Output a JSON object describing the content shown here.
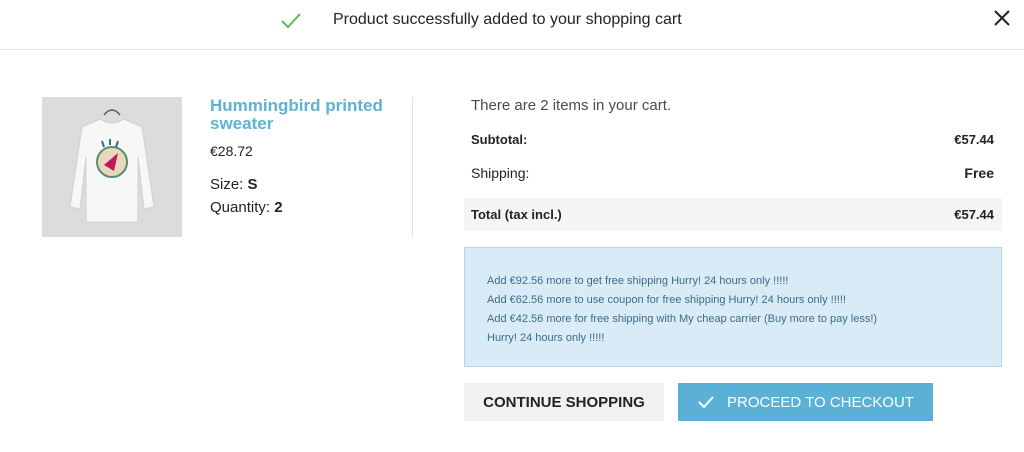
{
  "header": {
    "title": "Product successfully added to your shopping cart",
    "accent_color": "#5cb85c"
  },
  "product": {
    "name": "Hummingbird printed sweater",
    "price": "€28.72",
    "size_label": "Size: ",
    "size_value": "S",
    "quantity_label": "Quantity: ",
    "quantity_value": "2"
  },
  "cart": {
    "count_text": "There are 2 items in your cart.",
    "subtotal_label": "Subtotal:",
    "subtotal_value": "€57.44",
    "shipping_label": "Shipping:",
    "shipping_value": "Free",
    "total_label": "Total (tax incl.)",
    "total_value": "€57.44"
  },
  "alert": {
    "lines": [
      "Add €92.56 more to get free shipping Hurry! 24 hours only !!!!!",
      "Add €62.56 more to use coupon for free shipping Hurry! 24 hours only !!!!!",
      "Add €42.56 more for free shipping with My cheap carrier (Buy more to pay less!)",
      "Hurry! 24 hours only !!!!!"
    ]
  },
  "buttons": {
    "continue_label": "CONTINUE SHOPPING",
    "checkout_label": "PROCEED TO CHECKOUT",
    "checkout_color": "#5bb0d6"
  },
  "icons": {
    "success": "check-icon",
    "close": "close-icon",
    "checkout": "check-icon"
  }
}
